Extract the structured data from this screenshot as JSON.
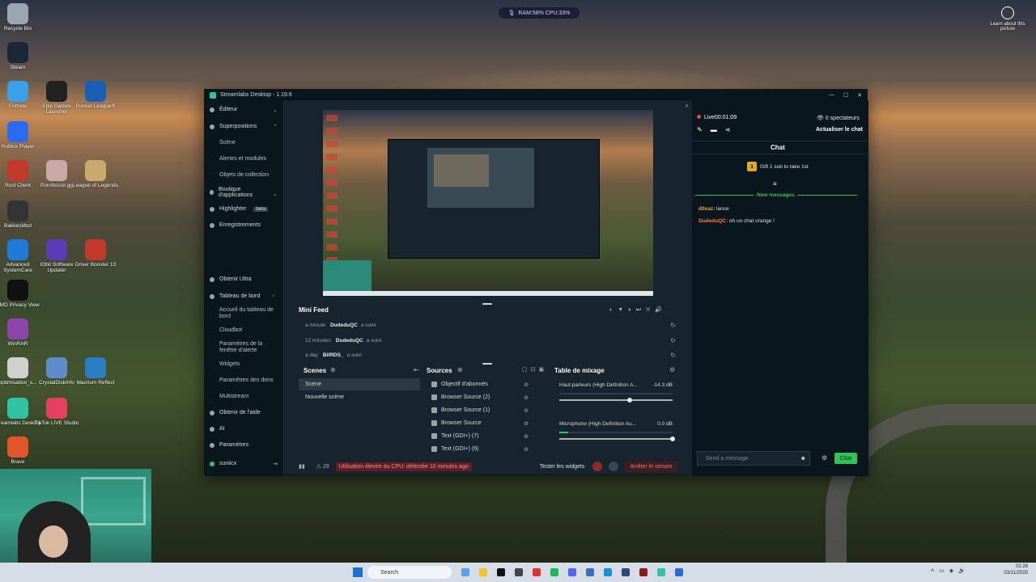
{
  "desktop": {
    "icons": [
      {
        "label": "Recycle Bin",
        "color": "#9aa6b0"
      },
      {
        "label": "Steam",
        "color": "#1b2838"
      },
      {
        "label": "Fortnite",
        "color": "#3aa0e8"
      },
      {
        "label": "Epic Games Launcher",
        "color": "#222"
      },
      {
        "label": "Rocket League®",
        "color": "#1a5fb4"
      },
      {
        "label": "Roblox Player",
        "color": "#2b6bf0"
      },
      {
        "label": "Rust Client",
        "color": "#c0392b"
      },
      {
        "label": "Porofessor.gg",
        "color": "#c9a8a8"
      },
      {
        "label": "League of Legends",
        "color": "#c8aa6e"
      },
      {
        "label": "BakkesMod",
        "color": "#333"
      },
      {
        "label": "Advanced SystemCare",
        "color": "#1f7ad9"
      },
      {
        "label": "IObit Software Updater",
        "color": "#5a3db5"
      },
      {
        "label": "Driver Booster 13",
        "color": "#c0392b"
      },
      {
        "label": "AMD Privacy View",
        "color": "#111"
      },
      {
        "label": "WinRAR",
        "color": "#8e44ad"
      },
      {
        "label": "optimisation_s...",
        "color": "#d0d0d0"
      },
      {
        "label": "CrystalDiskInfo",
        "color": "#5d8cc9"
      },
      {
        "label": "Macrium Reflect",
        "color": "#2a7fc4"
      },
      {
        "label": "Streamlabs Desktop",
        "color": "#31c3a2"
      },
      {
        "label": "TikTok LIVE Studio",
        "color": "#e4405f"
      },
      {
        "label": "Brave",
        "color": "#e1552c"
      }
    ],
    "system_widget": "RAM:58%  CPU:33%",
    "learn_text": "Learn about this picture"
  },
  "window": {
    "title": "Streamlabs Desktop - 1.19.6"
  },
  "sidebar": {
    "items": [
      {
        "label": "Éditeur"
      },
      {
        "label": "Superpositions"
      },
      {
        "label": "Scène"
      },
      {
        "label": "Alertes et modules"
      },
      {
        "label": "Objets de collection"
      },
      {
        "label": "Boutique d'applications"
      },
      {
        "label": "Highlighter"
      },
      {
        "label": "Enregistrements"
      },
      {
        "label": "Obtenir Ultra"
      },
      {
        "label": "Tableau de bord"
      },
      {
        "label": "Accueil du tableau de bord"
      },
      {
        "label": "Cloudbot"
      },
      {
        "label": "Paramètres de la fenêtre d'alerte"
      },
      {
        "label": "Widgets"
      },
      {
        "label": "Paramètres des dons"
      },
      {
        "label": "Multistream"
      },
      {
        "label": "Obtenir de l'aide"
      },
      {
        "label": "AI"
      },
      {
        "label": "Paramètres"
      }
    ],
    "beta": "beta",
    "user": "suniicx"
  },
  "minifeed": {
    "title": "Mini Feed",
    "rows": [
      {
        "time": "a minute",
        "user": "DudeduQC",
        "action": "a suivi"
      },
      {
        "time": "12 minutes",
        "user": "DudeduQC",
        "action": "a suivi"
      },
      {
        "time": "a day",
        "user": "BiIRDS_",
        "action": "a suivi"
      }
    ]
  },
  "scenes": {
    "title": "Scenes",
    "items": [
      "Scene",
      "Nouvelle scène"
    ]
  },
  "sources": {
    "title": "Sources",
    "items": [
      "Objectif d'abonnés",
      "Browser Source (2)",
      "Browser Source (1)",
      "Browser Source",
      "Text (GDI+) (7)",
      "Text (GDI+) (6)"
    ]
  },
  "mixer": {
    "title": "Table de mixage",
    "channels": [
      {
        "name": "Haut-parleurs (High Definition A...",
        "db": "-14.3 dB",
        "level": 0.62
      },
      {
        "name": "Microphone (High Definition Au...",
        "db": "0.0 dB",
        "level": 1.0
      }
    ]
  },
  "statusbar": {
    "count": "28",
    "cpu_warning": "Utilisation élevée du CPU: détectée 10 minutes ago",
    "test_widgets": "Tester les widgets",
    "stop_stream": "Arrêter le stream"
  },
  "chat": {
    "live": "Live",
    "timer": "00:01:09",
    "viewers": "0 spectateurs",
    "refresh": "Actualiser le chat",
    "title": "Chat",
    "gift_count": "1",
    "gift_text": "Gift 1 sub to take 1st",
    "new_messages": "New messages",
    "messages": [
      {
        "user": "d0xaz:",
        "text": "lance",
        "color": "#e8a94a"
      },
      {
        "user": "DudeduQC:",
        "text": "oh un chat orange !",
        "color": "#ff7a3d"
      }
    ],
    "placeholder": "Send a message",
    "send_label": "Chat"
  },
  "taskbar": {
    "search": "Search",
    "time": "02:28",
    "date": "03/11/2025"
  }
}
